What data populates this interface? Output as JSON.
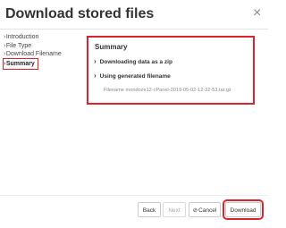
{
  "dialog": {
    "title": "Download stored files",
    "close_symbol": "×"
  },
  "nav": {
    "items": [
      {
        "label": "Introduction",
        "active": false
      },
      {
        "label": "File Type",
        "active": false
      },
      {
        "label": "Download Filename",
        "active": false
      },
      {
        "label": "Summary",
        "active": true
      }
    ]
  },
  "summary": {
    "title": "Summary",
    "steps": [
      {
        "label": "Downloading data as a zip"
      },
      {
        "label": "Using generated filename"
      }
    ],
    "filename": "Filename mondoze12-cPanel-2019-05-02-12-32-53.tar.gz"
  },
  "buttons": {
    "back": "Back",
    "next": "Next",
    "cancel": "Cancel",
    "download": "Download"
  },
  "icons": {
    "chevron": "chevron-right-icon",
    "cancel": "cancel-icon",
    "close": "close-icon"
  },
  "colors": {
    "highlight": "#d9232d",
    "muted_text": "#8a8a8a"
  }
}
